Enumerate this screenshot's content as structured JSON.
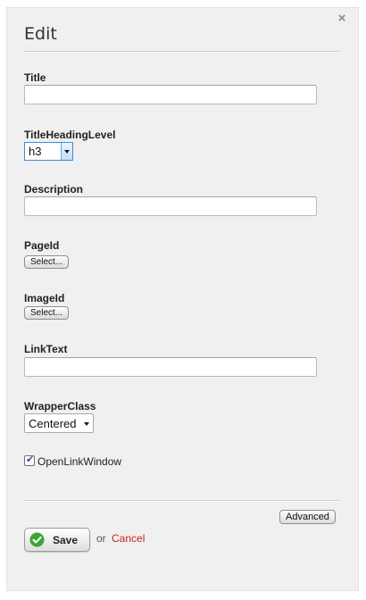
{
  "dialog": {
    "title": "Edit",
    "close_glyph": "×"
  },
  "fields": {
    "title": {
      "label": "Title",
      "value": ""
    },
    "title_heading_level": {
      "label": "TitleHeadingLevel",
      "selected": "h3"
    },
    "description": {
      "label": "Description",
      "value": ""
    },
    "page_id": {
      "label": "PageId",
      "button": "Select..."
    },
    "image_id": {
      "label": "ImageId",
      "button": "Select..."
    },
    "link_text": {
      "label": "LinkText",
      "value": ""
    },
    "wrapper_class": {
      "label": "WrapperClass",
      "selected": "Centered"
    },
    "open_link_window": {
      "label": "OpenLinkWindow",
      "checked": true
    }
  },
  "footer": {
    "advanced_label": "Advanced",
    "save_label": "Save",
    "or_text": "or",
    "cancel_label": "Cancel"
  },
  "colors": {
    "cancel": "#cc1f1f",
    "save_icon": "#3aa534",
    "panel_bg": "#f0f0f0"
  },
  "icons": {
    "close": "close-icon",
    "save": "checkmark-circle-icon",
    "dropdown": "chevron-down-icon",
    "checkbox": "checkmark-icon"
  }
}
